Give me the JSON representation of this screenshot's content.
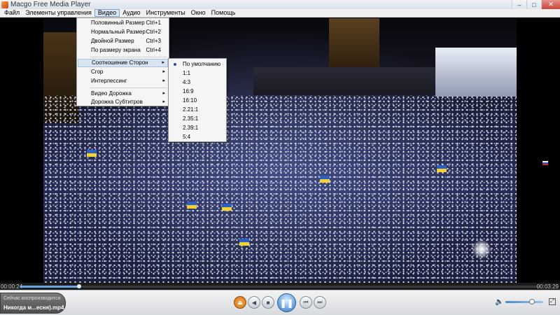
{
  "window": {
    "title": "Macgo Free Media Player",
    "min_glyph": "–",
    "max_glyph": "□",
    "close_glyph": "✕"
  },
  "menubar": [
    {
      "label": "Файл"
    },
    {
      "label": "Элементы управления"
    },
    {
      "label": "Видео",
      "active": true
    },
    {
      "label": "Аудио"
    },
    {
      "label": "Инструменты"
    },
    {
      "label": "Окно"
    },
    {
      "label": "Помощь"
    }
  ],
  "video_menu": {
    "items": [
      {
        "label": "Половинный Размер",
        "shortcut": "Ctrl+1"
      },
      {
        "label": "Нормальный Размер",
        "shortcut": "Ctrl+2"
      },
      {
        "label": "Двойной Размер",
        "shortcut": "Ctrl+3"
      },
      {
        "label": "По размеру экрана",
        "shortcut": "Ctrl+4"
      },
      {
        "label": "Соотношение Сторон",
        "submenu": true
      },
      {
        "label": "Crop",
        "submenu": true
      },
      {
        "label": "Интерлессинг",
        "submenu": true
      },
      {
        "label": "Видео Дорожка",
        "submenu": true
      },
      {
        "label": "Дорожка Субтитров",
        "submenu": true
      }
    ],
    "submenu_glyph": "▸"
  },
  "aspect_submenu": {
    "items": [
      {
        "label": "По умолчанию",
        "selected": true
      },
      {
        "label": "1:1"
      },
      {
        "label": "4:3"
      },
      {
        "label": "16:9"
      },
      {
        "label": "16:10"
      },
      {
        "label": "2.21:1"
      },
      {
        "label": "2.35:1"
      },
      {
        "label": "2.39:1"
      },
      {
        "label": "5:4"
      }
    ]
  },
  "playback": {
    "elapsed": "00:00:24",
    "total": "00:03:29",
    "progress": 0.115,
    "volume": 0.7
  },
  "now_playing": {
    "label": "Сейчас воспроизводится",
    "file": "Никогда м...есня).mp4"
  },
  "controls": {
    "open_glyph": "⏏",
    "stop_glyph": "■",
    "prev_glyph": "◀",
    "play_pause_glyph": "❚❚",
    "next_glyph": "▶",
    "skip_back_glyph": "⏮",
    "skip_fwd_glyph": "⏭",
    "volume_glyph": "🔈",
    "fullscreen_glyph": "⤢"
  },
  "icons": [
    "app-icon",
    "pause-icon",
    "volume-icon",
    "fullscreen-icon",
    "submenu-arrow-icon",
    "selected-bullet-icon"
  ]
}
